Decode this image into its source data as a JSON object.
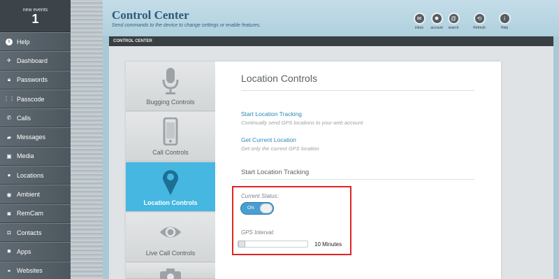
{
  "sidebar": {
    "events_label": "new events",
    "events_count": "1",
    "items": [
      {
        "label": "Help",
        "icon": "help-icon"
      },
      {
        "label": "Dashboard",
        "icon": "dashboard-icon"
      },
      {
        "label": "Passwords",
        "icon": "lock-icon"
      },
      {
        "label": "Passcode",
        "icon": "keypad-icon"
      },
      {
        "label": "Calls",
        "icon": "phone-icon"
      },
      {
        "label": "Messages",
        "icon": "message-icon"
      },
      {
        "label": "Media",
        "icon": "image-icon"
      },
      {
        "label": "Locations",
        "icon": "pin-icon"
      },
      {
        "label": "Ambient",
        "icon": "ambient-icon"
      },
      {
        "label": "RemCam",
        "icon": "camera-icon"
      },
      {
        "label": "Contacts",
        "icon": "contacts-icon"
      },
      {
        "label": "Apps",
        "icon": "gear-icon"
      },
      {
        "label": "Websites",
        "icon": "link-icon"
      }
    ]
  },
  "header": {
    "title": "Control Center",
    "subtitle": "Send commands to the device to change settings or enable features.",
    "toolbar": [
      {
        "label": "inbox",
        "icon": "mail-icon"
      },
      {
        "label": "account",
        "icon": "gear-icon"
      },
      {
        "label": "search",
        "icon": "at-icon"
      },
      {
        "label": "Refresh",
        "icon": "refresh-icon"
      },
      {
        "label": "Help",
        "icon": "info-icon"
      }
    ]
  },
  "panel": {
    "header": "CONTROL CENTER",
    "tabs": [
      {
        "label": "Bugging Controls",
        "icon": "microphone-icon"
      },
      {
        "label": "Call Controls",
        "icon": "phone-device-icon"
      },
      {
        "label": "Location Controls",
        "icon": "location-pin-icon",
        "active": true
      },
      {
        "label": "Live Call Controls",
        "icon": "eye-icon"
      },
      {
        "label": "",
        "icon": "camera-icon"
      }
    ]
  },
  "content": {
    "title": "Location Controls",
    "links": [
      {
        "label": "Start Location Tracking",
        "description": "Continually send GPS locations to your web account"
      },
      {
        "label": "Get Current Location",
        "description": "Get only the current GPS location"
      }
    ],
    "section_title": "Start Location Tracking",
    "status_label": "Current Status:",
    "toggle_state": "ON",
    "interval_label": "GPS Interval:",
    "interval_value": "10 Minutes"
  },
  "colors": {
    "accent": "#46b7e1",
    "link": "#2a87b8",
    "highlight": "#e02424"
  }
}
